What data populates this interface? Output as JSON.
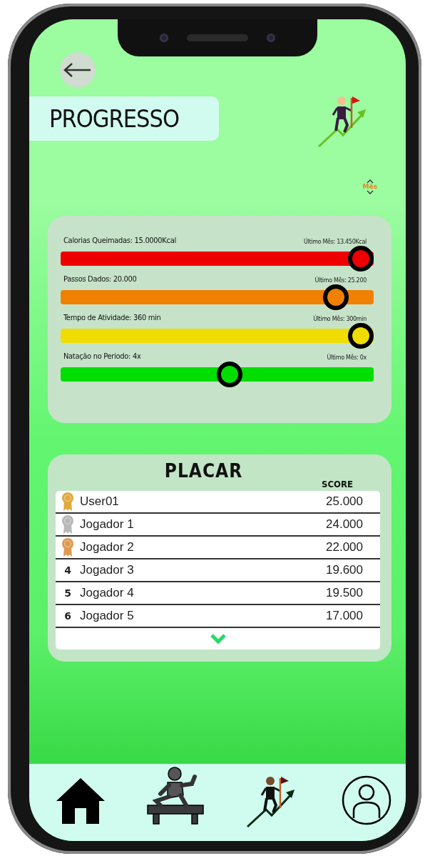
{
  "header": {
    "title": "PROGRESSO"
  },
  "period": {
    "label": "Mês"
  },
  "stats": [
    {
      "label": "Calorias Queimadas: 15.0000Kcal",
      "last_month": "Último Mês: 13.450Kcal",
      "level": 0.96,
      "color": "#ef0000"
    },
    {
      "label": "Passos Dados: 20.000",
      "last_month": "Último Mês: 25.200",
      "level": 0.88,
      "color": "#f08000"
    },
    {
      "label": "Tempo de Atividade: 360 min",
      "last_month": "Último Mês: 300min",
      "level": 0.96,
      "color": "#f0dc00"
    },
    {
      "label": "Natação  no Periodo: 4x",
      "last_month": "Último Mês: 0x",
      "level": 0.54,
      "color": "#00dd00"
    }
  ],
  "leaderboard": {
    "title": "PLACAR",
    "score_header": "SCORE",
    "rows": [
      {
        "kind": "medal",
        "color": "#e0aa3e",
        "name": "User01",
        "score": "25.000"
      },
      {
        "kind": "medal",
        "color": "#b8b8b8",
        "name": "Jogador 1",
        "score": "24.000"
      },
      {
        "kind": "medal",
        "color": "#e09a50",
        "name": "Jogador 2",
        "score": "22.000"
      },
      {
        "kind": "number",
        "rank": "4",
        "name": "Jogador 3",
        "score": "19.600"
      },
      {
        "kind": "number",
        "rank": "5",
        "name": "Jogador 4",
        "score": "19.500"
      },
      {
        "kind": "number",
        "rank": "6",
        "name": "Jogador 5",
        "score": "17.000"
      }
    ]
  }
}
